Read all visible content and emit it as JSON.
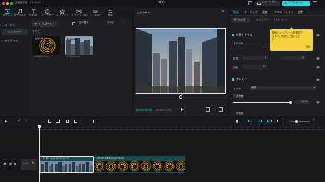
{
  "titlebar": {
    "autosave": "自動保存済：16:40:07",
    "project": "0322",
    "shortcut_label": "ショートカット",
    "export_label": "エクスポート"
  },
  "media_tools": [
    {
      "label": "メディア",
      "icon": "media-icon"
    },
    {
      "label": "オーディオ",
      "icon": "audio-icon"
    },
    {
      "label": "テキスト",
      "icon": "text-icon"
    },
    {
      "label": "ステッカー",
      "icon": "sticker-icon"
    },
    {
      "label": "エフェクト",
      "icon": "effect-icon"
    },
    {
      "label": "トランジション",
      "icon": "transition-icon"
    },
    {
      "label": "フィルター",
      "icon": "filter-icon"
    },
    {
      "label": "調整",
      "icon": "adjust-icon"
    }
  ],
  "sidebar": {
    "items": [
      "ローカル",
      "インポート",
      "ライブラリ"
    ]
  },
  "library": {
    "import_label": "インポート",
    "sort_label": "並べ替え",
    "all_label": "すべて",
    "all_heading": "すべて",
    "thumbs": [
      {
        "badge": "追加済み",
        "name": "-155865.mp4"
      },
      {
        "badge": "追加済み",
        "name": "-97144.mp4"
      }
    ]
  },
  "player": {
    "title": "プレーヤー",
    "timecode_current": "00:00:00:00",
    "timecode_total": "00:00:47:02"
  },
  "inspector": {
    "tabs": [
      "動画",
      "オーディオ",
      "速度",
      "アニメーション",
      "調整"
    ],
    "subtabs": [
      "ベーシック",
      "カットアウト",
      "マスク",
      "カラー"
    ],
    "section_position": "位置とサイズ",
    "scale_label": "スケール",
    "position_label": "位置",
    "position_x": "0",
    "position_y": "0",
    "rotate_label": "回転",
    "rotate_value": "0°",
    "blend_section": "ブレンド",
    "mode_label": "モード",
    "mode_value": "通常",
    "opacity_label": "不透明度",
    "opacity_value": "100%",
    "opacity_level": 1.0,
    "stabilize_label": "安定化",
    "tooltip_text": "動画にキーフレームを追加できます。詳細をご覧ください。",
    "tooltip_ok": "OK"
  },
  "timeline": {
    "clip1_label": "-97144.mp4   00:00:17:22",
    "clip2_label": "-155865.mp4   00:00:29:05",
    "cover_label": "カバー"
  },
  "colors": {
    "accent": "#2fd3dc",
    "tooltip": "#f6d33c",
    "clip": "#1c4a4e"
  }
}
